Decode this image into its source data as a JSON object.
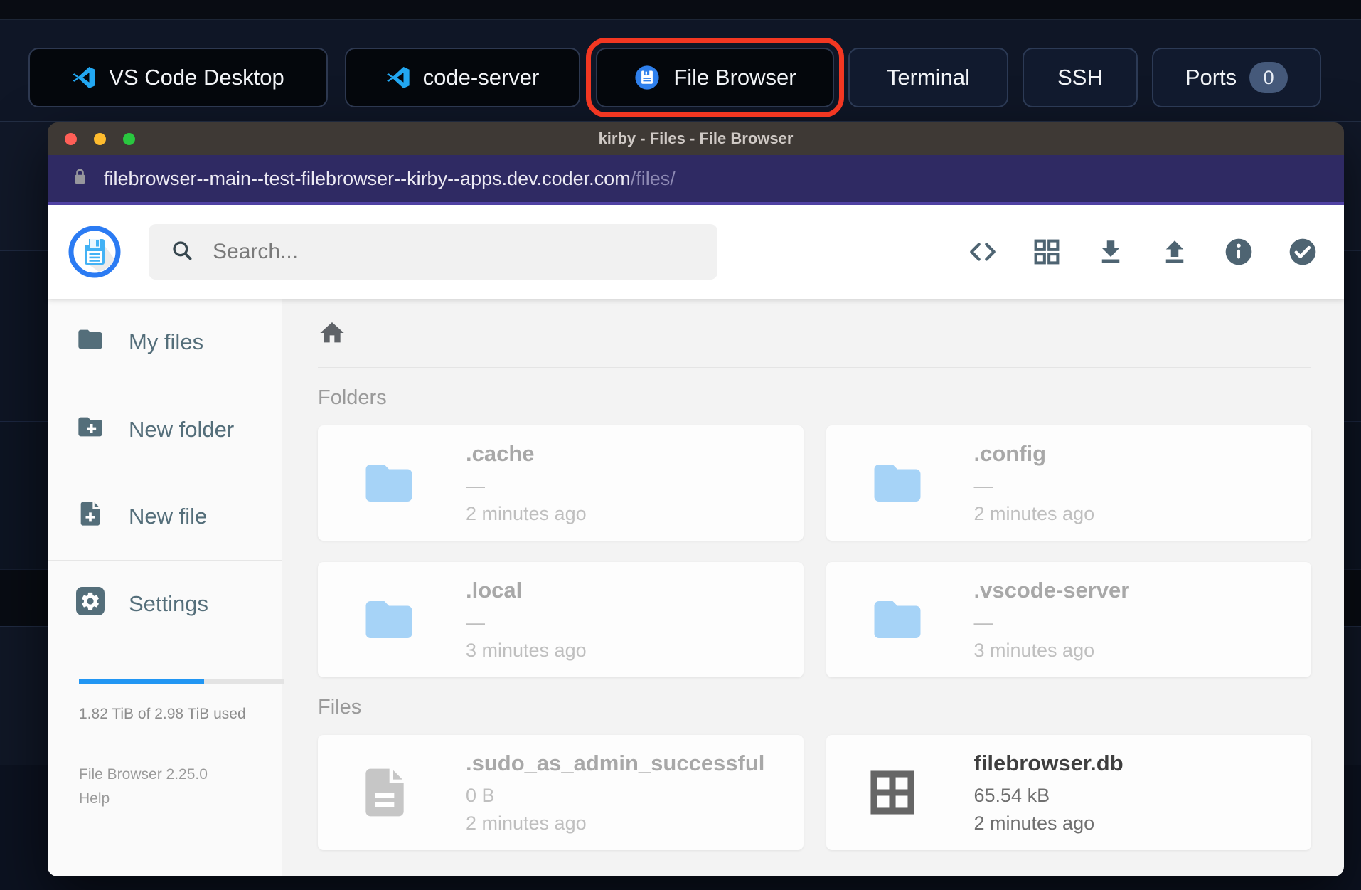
{
  "topbar": {
    "buttons": [
      {
        "label": "VS Code Desktop",
        "icon": "vscode-icon"
      },
      {
        "label": "code-server",
        "icon": "vscode-icon"
      },
      {
        "label": "File Browser",
        "icon": "filebrowser-icon",
        "highlighted": true
      },
      {
        "label": "Terminal"
      },
      {
        "label": "SSH"
      },
      {
        "label": "Ports",
        "badge": "0"
      }
    ]
  },
  "browser_window": {
    "title": "kirby - Files - File Browser",
    "url_host": "filebrowser--main--test-filebrowser--kirby--apps.dev.coder.com",
    "url_path": "/files/"
  },
  "header": {
    "search_placeholder": "Search...",
    "icons": [
      "code-icon",
      "grid-icon",
      "download-icon",
      "upload-icon",
      "info-icon",
      "check-circle-icon"
    ]
  },
  "sidebar": {
    "items": [
      {
        "label": "My files",
        "icon": "folder-icon"
      },
      {
        "label": "New folder",
        "icon": "folder-plus-icon"
      },
      {
        "label": "New file",
        "icon": "file-plus-icon"
      },
      {
        "label": "Settings",
        "icon": "gear-icon"
      }
    ],
    "usage_percent": 61,
    "usage_text": "1.82 TiB of 2.98 TiB used",
    "version": "File Browser 2.25.0",
    "help_label": "Help"
  },
  "content": {
    "folders_heading": "Folders",
    "files_heading": "Files",
    "folders": [
      {
        "name": ".cache",
        "size": "—",
        "time": "2 minutes ago"
      },
      {
        "name": ".config",
        "size": "—",
        "time": "2 minutes ago"
      },
      {
        "name": ".local",
        "size": "—",
        "time": "3 minutes ago"
      },
      {
        "name": ".vscode-server",
        "size": "—",
        "time": "3 minutes ago"
      }
    ],
    "files": [
      {
        "name": ".sudo_as_admin_successful",
        "size": "0 B",
        "time": "2 minutes ago",
        "icon": "document-icon"
      },
      {
        "name": "filebrowser.db",
        "size": "65.54 kB",
        "time": "2 minutes ago",
        "icon": "grid-window-icon"
      }
    ]
  },
  "colors": {
    "accent_blue": "#2196f3",
    "highlight_red": "#f23722",
    "folder_blue": "#a6d3f7",
    "icon_slate": "#4e6472",
    "url_bar_purple": "#2f2a63"
  }
}
